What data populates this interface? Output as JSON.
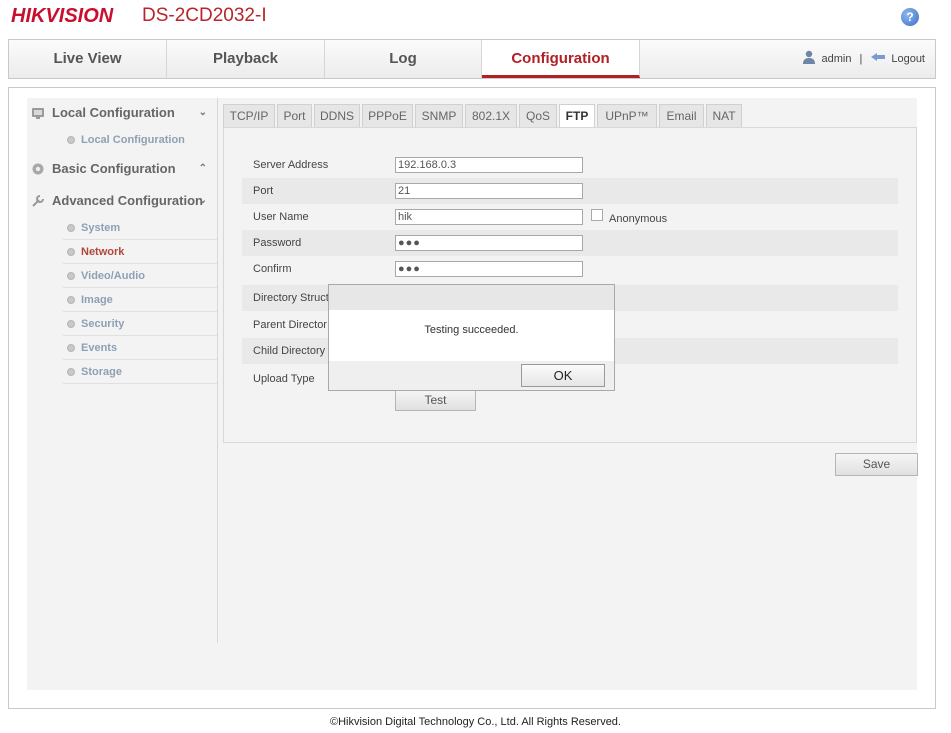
{
  "header": {
    "brand": "HIKVISION",
    "model": "DS-2CD2032-I",
    "help_label": "?"
  },
  "nav": {
    "tabs": [
      "Live View",
      "Playback",
      "Log",
      "Configuration"
    ],
    "active": "Configuration",
    "user": "admin",
    "separator": "|",
    "logout": "Logout"
  },
  "sidebar": {
    "local": {
      "label": "Local Configuration",
      "chevron": "⌄",
      "items": [
        "Local Configuration"
      ]
    },
    "basic": {
      "label": "Basic Configuration",
      "chevron": "⌃"
    },
    "advanced": {
      "label": "Advanced Configuration",
      "chevron": "⌄",
      "items": [
        "System",
        "Network",
        "Video/Audio",
        "Image",
        "Security",
        "Events",
        "Storage"
      ],
      "active": "Network"
    }
  },
  "subtabs": [
    "TCP/IP",
    "Port",
    "DDNS",
    "PPPoE",
    "SNMP",
    "802.1X",
    "QoS",
    "FTP",
    "UPnP™",
    "Email",
    "NAT"
  ],
  "active_subtab": "FTP",
  "form": {
    "server_address": {
      "label": "Server Address",
      "value": "192.168.0.3"
    },
    "port": {
      "label": "Port",
      "value": "21"
    },
    "user_name": {
      "label": "User Name",
      "value": "hik"
    },
    "anonymous": {
      "label": "Anonymous",
      "checked": false
    },
    "password": {
      "label": "Password",
      "value": "●●●"
    },
    "confirm": {
      "label": "Confirm",
      "value": "●●●"
    },
    "directory_structure": {
      "label": "Directory Struct"
    },
    "parent_directory": {
      "label": "Parent Director"
    },
    "child_directory": {
      "label": "Child Directory"
    },
    "upload_type": {
      "label": "Upload Type"
    },
    "test_button": "Test"
  },
  "save_button": "Save",
  "dialog": {
    "message": "Testing succeeded.",
    "ok_label": "OK"
  },
  "footer": "©Hikvision Digital Technology Co., Ltd. All Rights Reserved.",
  "colors": {
    "accent": "#b02025",
    "brand": "#c8102e"
  }
}
